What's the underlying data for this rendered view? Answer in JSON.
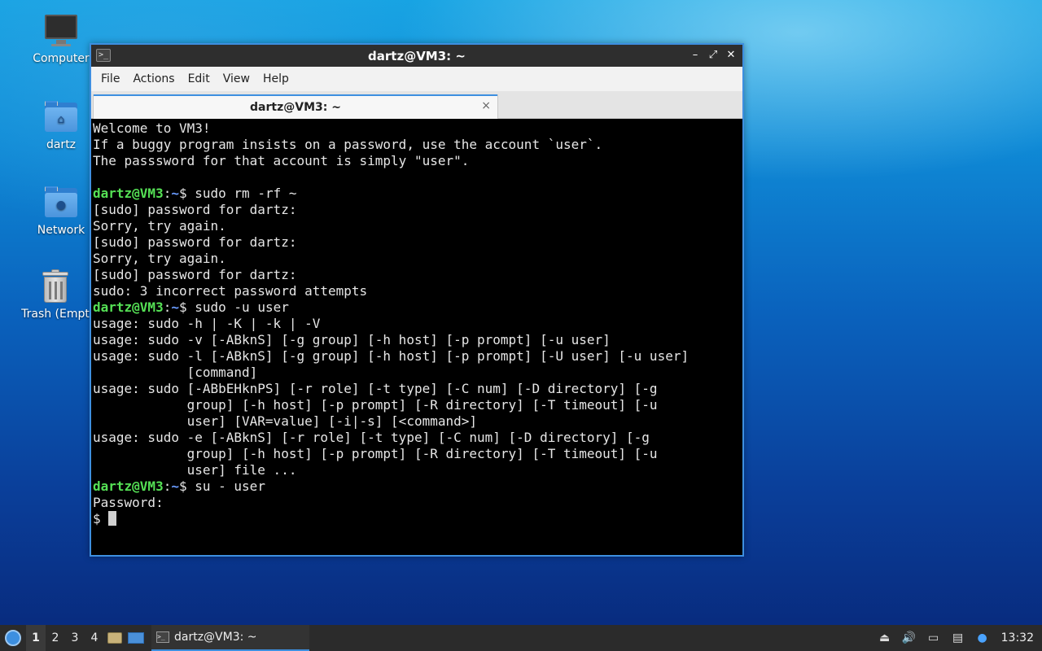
{
  "desktop": {
    "icons": [
      {
        "label": "Computer",
        "icon": "computer-icon"
      },
      {
        "label": "dartz",
        "icon": "home-folder-icon"
      },
      {
        "label": "Network",
        "icon": "network-folder-icon"
      },
      {
        "label": "Trash (Empt",
        "icon": "trash-icon"
      }
    ]
  },
  "window": {
    "title": "dartz@VM3: ~",
    "menu": [
      "File",
      "Actions",
      "Edit",
      "View",
      "Help"
    ],
    "tab_label": "dartz@VM3: ~",
    "tab_close": "×"
  },
  "terminal": {
    "lines": [
      "Welcome to VM3!",
      "If a buggy program insists on a password, use the account `user`.",
      "The passsword for that account is simply \"user\".",
      "",
      {
        "user": "dartz@VM3",
        "path": "~",
        "cmd": " sudo rm -rf ~"
      },
      "[sudo] password for dartz:",
      "Sorry, try again.",
      "[sudo] password for dartz:",
      "Sorry, try again.",
      "[sudo] password for dartz:",
      "sudo: 3 incorrect password attempts",
      {
        "user": "dartz@VM3",
        "path": "~",
        "cmd": " sudo -u user"
      },
      "usage: sudo -h | -K | -k | -V",
      "usage: sudo -v [-ABknS] [-g group] [-h host] [-p prompt] [-u user]",
      "usage: sudo -l [-ABknS] [-g group] [-h host] [-p prompt] [-U user] [-u user]",
      "            [command]",
      "usage: sudo [-ABbEHknPS] [-r role] [-t type] [-C num] [-D directory] [-g",
      "            group] [-h host] [-p prompt] [-R directory] [-T timeout] [-u",
      "            user] [VAR=value] [-i|-s] [<command>]",
      "usage: sudo -e [-ABknS] [-r role] [-t type] [-C num] [-D directory] [-g",
      "            group] [-h host] [-p prompt] [-R directory] [-T timeout] [-u",
      "            user] file ...",
      {
        "user": "dartz@VM3",
        "path": "~",
        "cmd": " su - user"
      },
      "Password:",
      "$ "
    ]
  },
  "taskbar": {
    "workspaces": [
      "1",
      "2",
      "3",
      "4"
    ],
    "active_workspace": "1",
    "task_label": "dartz@VM3: ~",
    "clock": "13:32"
  }
}
